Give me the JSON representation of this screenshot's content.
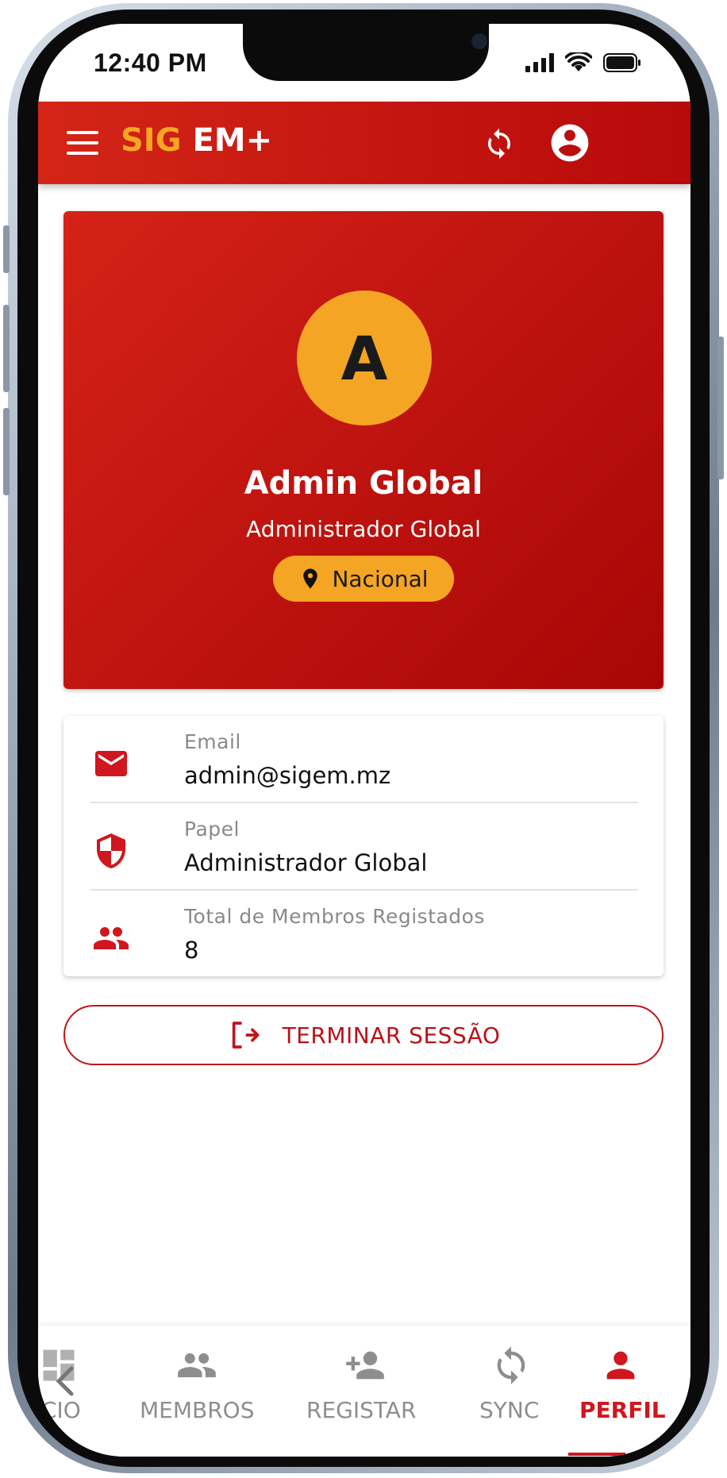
{
  "status_bar": {
    "time": "12:40 PM"
  },
  "app_bar": {
    "brand_sig": "SIG",
    "brand_em": "EM+"
  },
  "profile": {
    "initial": "A",
    "name": "Admin Global",
    "role": "Administrador Global",
    "scope": "Nacional"
  },
  "info": {
    "email_label": "Email",
    "email_value": "admin@sigem.mz",
    "role_label": "Papel",
    "role_value": "Administrador Global",
    "members_label": "Total de Membros Registados",
    "members_value": "8"
  },
  "logout_label": "TERMINAR SESSÃO",
  "bottom_nav": {
    "items": [
      {
        "label": "CIO",
        "icon": "dashboard-icon"
      },
      {
        "label": "MEMBROS",
        "icon": "people-icon"
      },
      {
        "label": "REGISTAR",
        "icon": "person-add-icon"
      },
      {
        "label": "SYNC",
        "icon": "sync-icon"
      },
      {
        "label": "PERFIL",
        "icon": "person-icon"
      }
    ],
    "active": "PERFIL"
  },
  "colors": {
    "primary_red": "#c8161c",
    "accent_orange": "#f5a524",
    "muted_gray": "#8e8e8e"
  }
}
